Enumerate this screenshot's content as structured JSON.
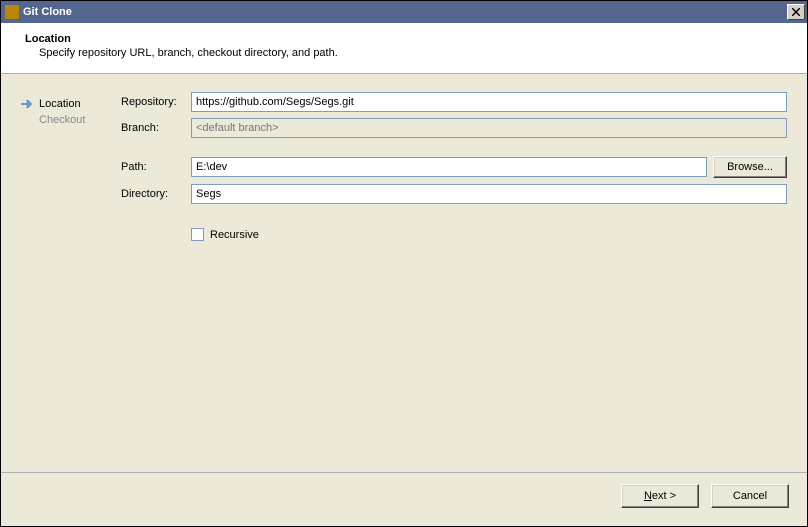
{
  "window": {
    "title": "Git Clone"
  },
  "header": {
    "title": "Location",
    "description": "Specify repository URL, branch, checkout directory, and path."
  },
  "sidebar": {
    "items": [
      {
        "label": "Location",
        "active": true
      },
      {
        "label": "Checkout",
        "active": false
      }
    ]
  },
  "form": {
    "repository": {
      "label": "Repository:",
      "value": "https://github.com/Segs/Segs.git"
    },
    "branch": {
      "label": "Branch:",
      "placeholder": "<default branch>",
      "value": ""
    },
    "path": {
      "label": "Path:",
      "value": "E:\\dev"
    },
    "browse_label": "Browse...",
    "directory": {
      "label": "Directory:",
      "value": "Segs"
    },
    "recursive": {
      "label": "Recursive",
      "checked": false
    }
  },
  "footer": {
    "next_prefix": "N",
    "next_suffix": "ext >",
    "cancel": "Cancel"
  }
}
